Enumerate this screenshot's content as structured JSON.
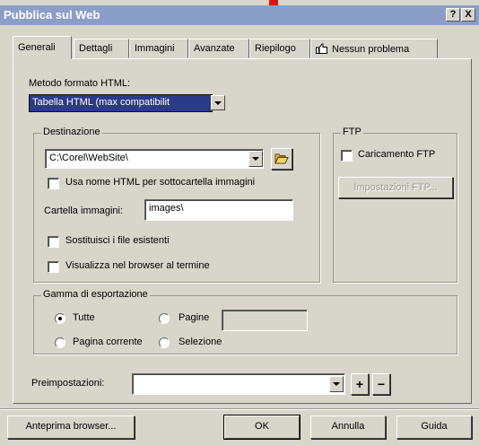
{
  "window": {
    "title": "Pubblica sul Web",
    "help_glyph": "?",
    "close_glyph": "X"
  },
  "tabs": [
    {
      "label": "Generali"
    },
    {
      "label": "Dettagli"
    },
    {
      "label": "Immagini"
    },
    {
      "label": "Avanzate"
    },
    {
      "label": "Riepilogo"
    },
    {
      "label": "Nessun problema"
    }
  ],
  "format": {
    "label": "Metodo formato HTML:",
    "value": "Tabella HTML (max compatibilit"
  },
  "destination": {
    "group_label": "Destinazione",
    "path": "C:\\Corel\\WebSite\\",
    "use_html_name_label": "Usa nome HTML per sottocartella immagini",
    "images_folder_label": "Cartella immagini:",
    "images_folder_value": "images\\",
    "replace_files_label": "Sostituisci i file esistenti",
    "show_browser_label": "Visualizza nel browser al termine"
  },
  "ftp": {
    "group_label": "FTP",
    "upload_label": "Caricamento FTP",
    "settings_button": "Impostazioni FTP..."
  },
  "export_range": {
    "group_label": "Gamma di esportazione",
    "all_label": "Tutte",
    "pages_label": "Pagine",
    "pages_value": "",
    "current_page_label": "Pagina corrente",
    "selection_label": "Selezione"
  },
  "presets": {
    "label": "Preimpostazioni:",
    "value": "",
    "add_glyph": "+",
    "remove_glyph": "−"
  },
  "footer": {
    "preview_button": "Anteprima browser...",
    "ok_button": "OK",
    "cancel_button": "Annulla",
    "help_button": "Guida"
  },
  "colors": {
    "title_bar": "#8b9ec8",
    "selection": "#2c3a8a",
    "accent": "#e2120b"
  }
}
